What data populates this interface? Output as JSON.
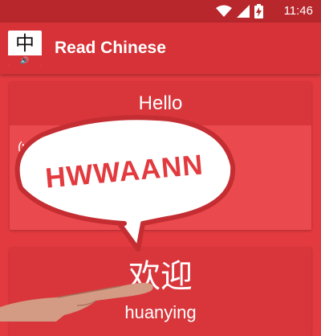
{
  "status_bar": {
    "time": "11:46",
    "icons": [
      "wifi-icon",
      "signal-icon",
      "battery-charging-icon"
    ]
  },
  "app_bar": {
    "logo": {
      "glyph": "中",
      "speaker_glyph": "🔊"
    },
    "title": "Read Chinese"
  },
  "colors": {
    "primary": "#d63237",
    "status_bar": "#b7272c",
    "background": "#e23a3f",
    "card": "#ea4a4e"
  },
  "cards": {
    "english": {
      "word": "Hello",
      "definition": "(v) A amongst fri"
    },
    "chinese": {
      "hanzi": "欢迎",
      "pinyin": "huanying"
    }
  },
  "speech_bubble": {
    "text": "HWWAANN"
  }
}
